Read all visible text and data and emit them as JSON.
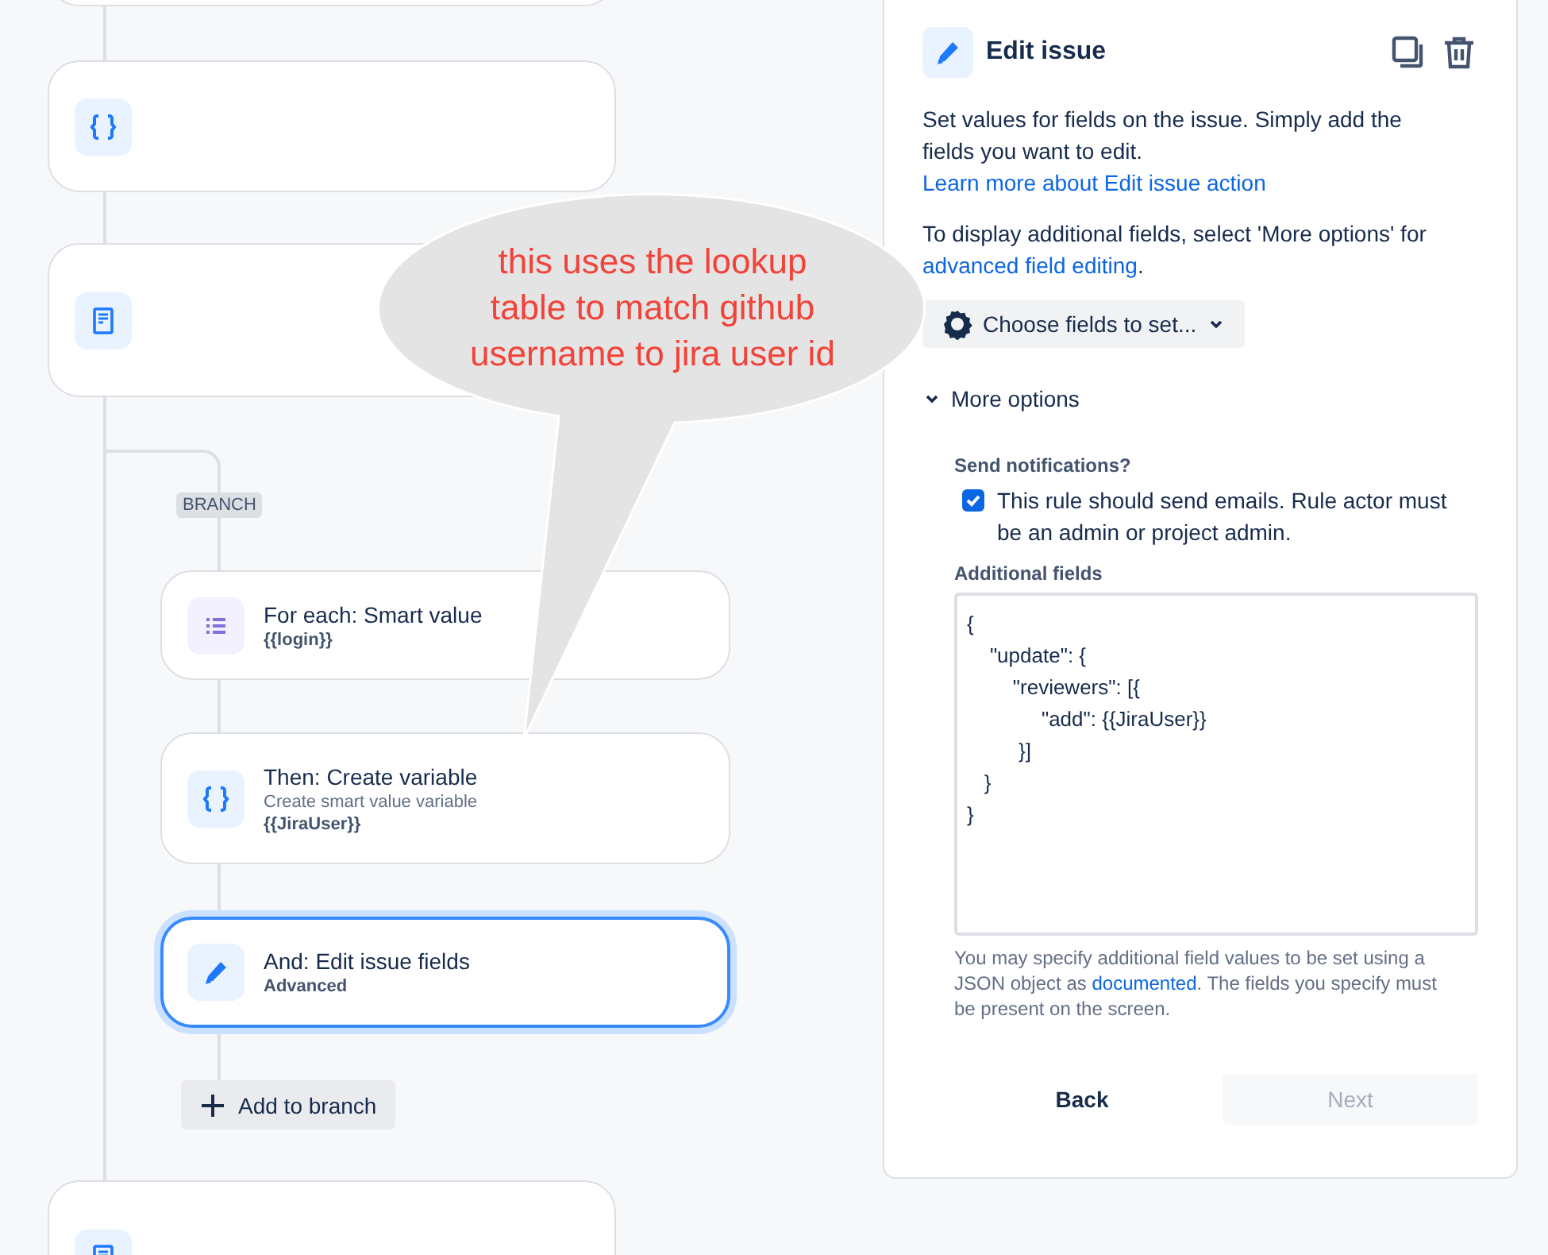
{
  "flow": {
    "steps": [
      {
        "kind": "blank"
      },
      {
        "kind": "variable"
      },
      {
        "kind": "document"
      },
      {
        "kind": "document"
      }
    ],
    "branch": {
      "label": "BRANCH",
      "steps": [
        {
          "kind": "loop",
          "title": "For each: Smart value",
          "detail": "{{login}}",
          "selected": false
        },
        {
          "kind": "variable",
          "title": "Then: Create variable",
          "subtitle": "Create smart value variable",
          "detail": "{{JiraUser}}",
          "selected": false
        },
        {
          "kind": "edit",
          "title": "And: Edit issue fields",
          "detail": "Advanced",
          "selected": true
        }
      ],
      "add_button": "Add to branch"
    }
  },
  "callout": {
    "text": "this uses the lookup\ntable to match github\nusername to jira user id"
  },
  "panel": {
    "title": "Edit issue",
    "intro": {
      "text": "Set values for fields on the issue. Simply add the fields you want to edit.",
      "link": "Learn more about Edit issue action"
    },
    "hint": {
      "text": "To display additional fields, select 'More options' for",
      "link": "advanced field editing",
      "after": "."
    },
    "choose_button": "Choose fields to set...",
    "more_options": {
      "label": "More options",
      "expanded": true
    },
    "notifications": {
      "label": "Send notifications?",
      "option": "This rule should send emails. Rule actor must be an admin or project admin.",
      "checked": true
    },
    "additional_fields": {
      "label": "Additional fields",
      "value": "{\n    \"update\": {\n        \"reviewers\": [{\n             \"add\": {{JiraUser}}\n         }]\n   }\n}",
      "help": {
        "text": "You may specify additional field values to be set using a JSON object as",
        "link": "documented",
        "after": ". The fields you specify must be present on the screen."
      }
    },
    "buttons": [
      {
        "label": "Back",
        "disabled": false
      },
      {
        "label": "Next",
        "disabled": true
      }
    ]
  }
}
